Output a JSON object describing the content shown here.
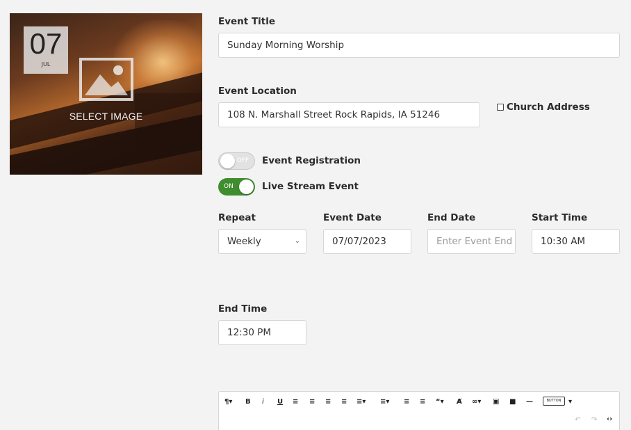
{
  "image": {
    "day": "07",
    "month": "JUL",
    "select_label": "SELECT IMAGE"
  },
  "form": {
    "title_label": "Event Title",
    "title_value": "Sunday Morning Worship",
    "location_label": "Event Location",
    "location_value": "108 N. Marshall Street  Rock Rapids, IA 51246",
    "church_address_label": "Church Address",
    "registration_label": "Event Registration",
    "registration_toggle": "OFF",
    "livestream_label": "Live Stream Event",
    "livestream_toggle": "ON",
    "repeat_label": "Repeat",
    "repeat_value": "Weekly",
    "event_date_label": "Event Date",
    "event_date_value": "07/07/2023",
    "end_date_label": "End Date",
    "end_date_placeholder": "Enter Event End",
    "start_time_label": "Start Time",
    "start_time_value": "10:30 AM",
    "end_time_label": "End Time",
    "end_time_value": "12:30 PM"
  },
  "editor": {
    "toolbar": [
      "paragraph-icon",
      "bold-icon",
      "italic-icon",
      "underline-icon",
      "align-left-icon",
      "align-center-icon",
      "align-right-icon",
      "justify-icon",
      "ordered-list-icon",
      "bullet-list-icon",
      "outdent-icon",
      "indent-icon",
      "quote-icon",
      "clear-format-icon",
      "link-icon",
      "image-icon",
      "video-icon",
      "horizontal-rule-icon",
      "button-insert",
      "undo-icon",
      "redo-icon",
      "code-view-icon"
    ],
    "button_chip": "BUTTON"
  }
}
